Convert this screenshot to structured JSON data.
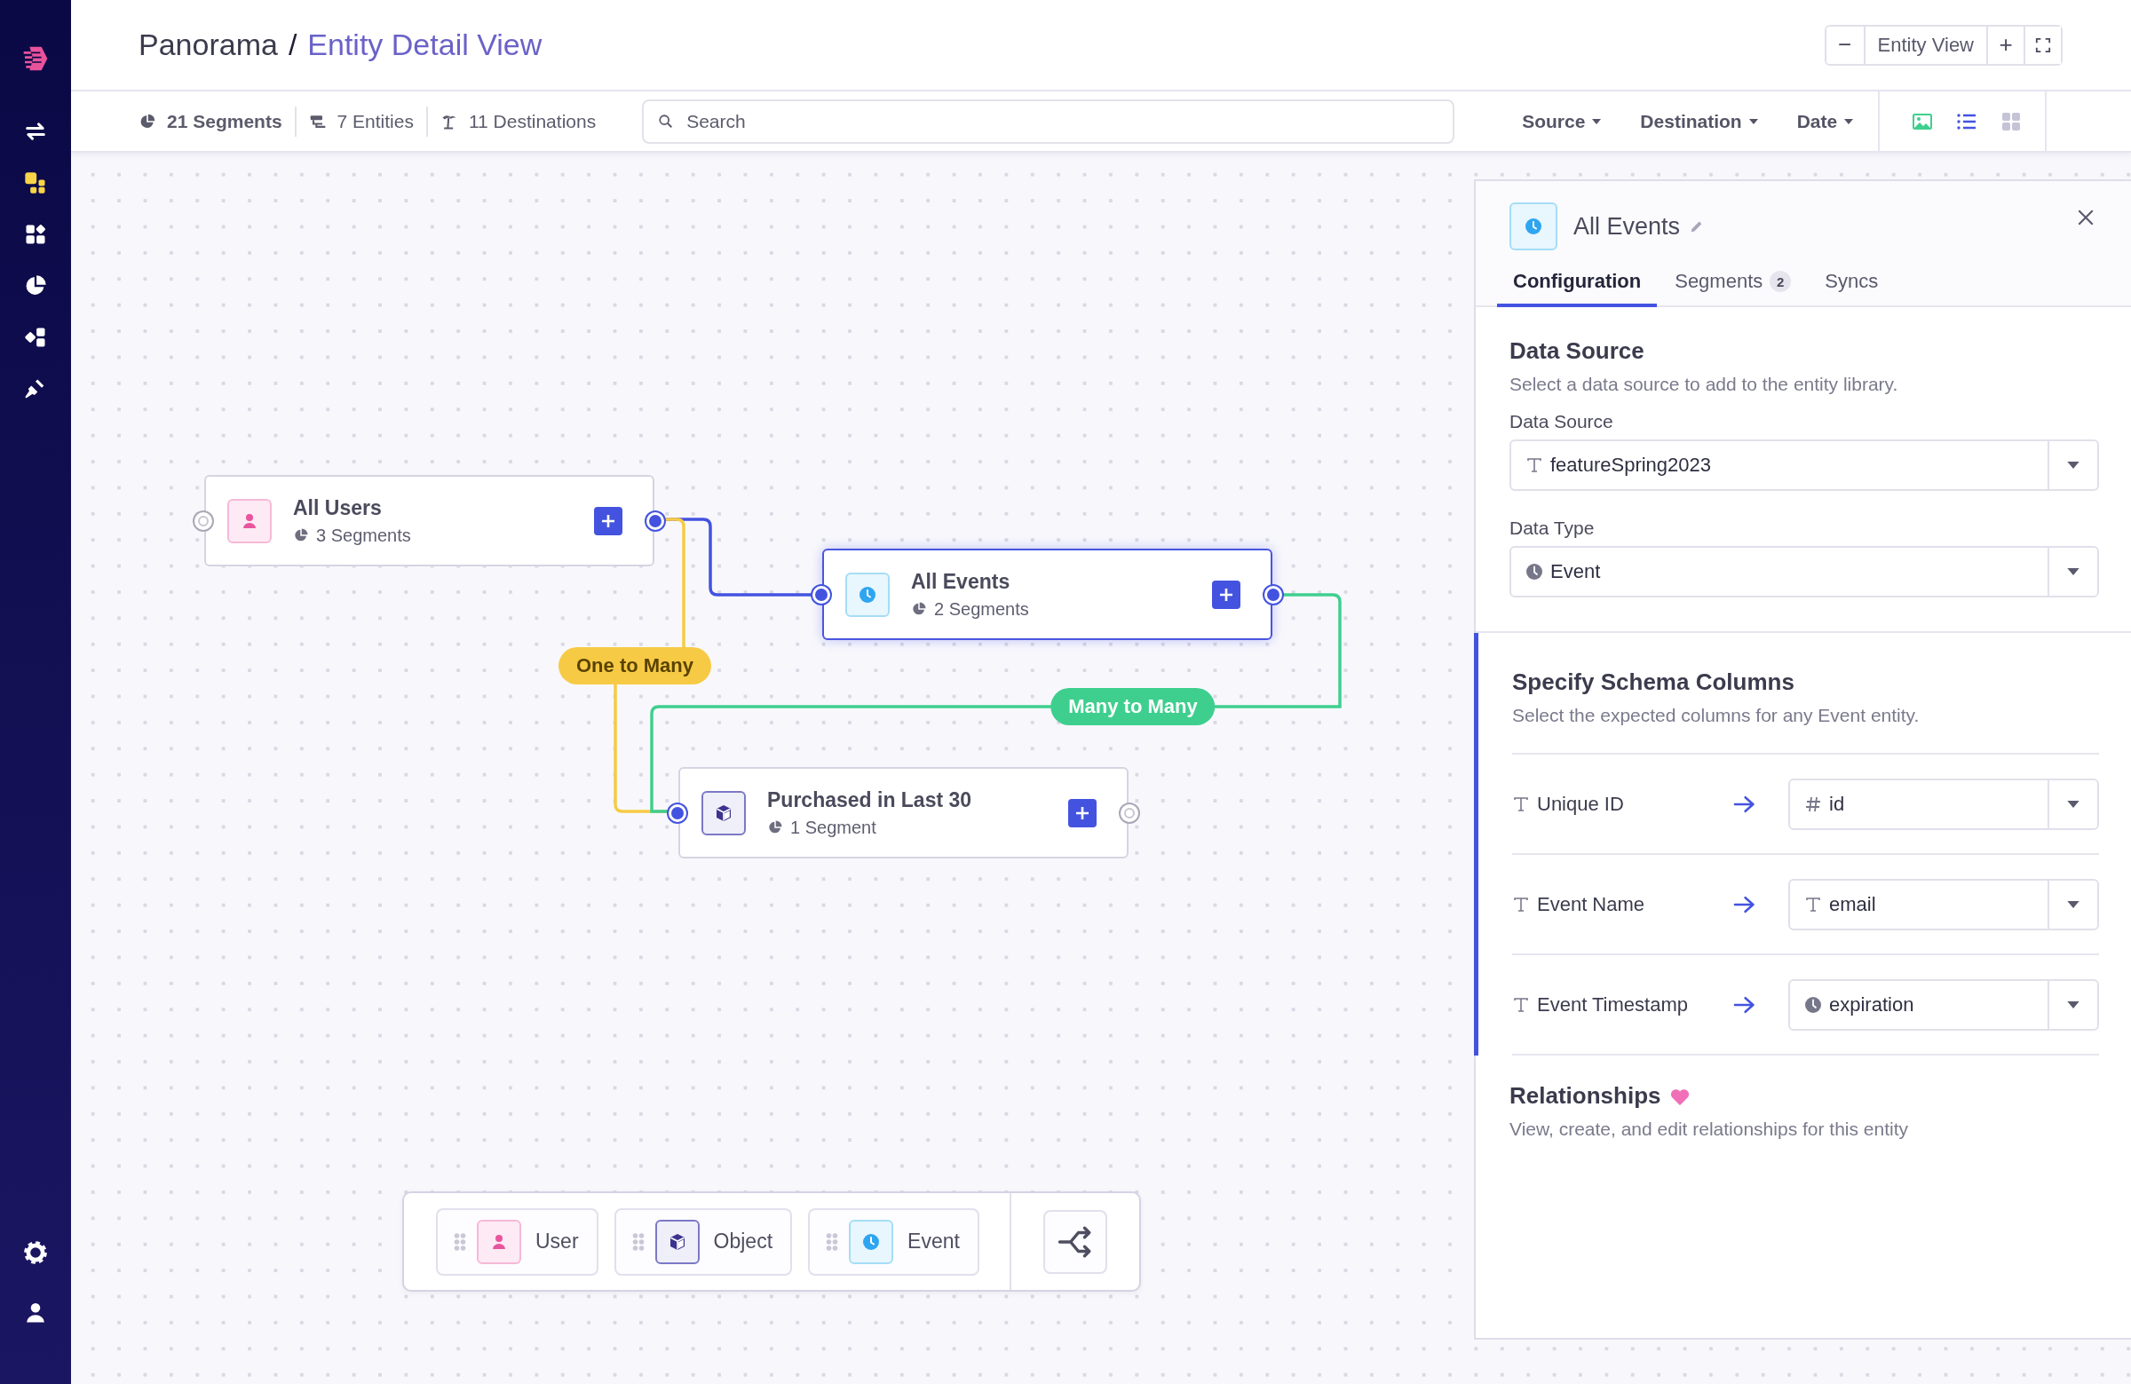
{
  "sidebar": {
    "items": [
      {
        "kind": "swap",
        "selected": false
      },
      {
        "kind": "entities",
        "selected": true
      },
      {
        "kind": "apps",
        "selected": false
      },
      {
        "kind": "segments",
        "selected": false
      },
      {
        "kind": "flows",
        "selected": false
      },
      {
        "kind": "plugins",
        "selected": false
      }
    ],
    "bottom_items": [
      {
        "kind": "settings"
      },
      {
        "kind": "profile"
      }
    ]
  },
  "header": {
    "breadcrumb": {
      "root": "Panorama",
      "separator": "/",
      "current": "Entity Detail View"
    },
    "zoom": {
      "minus": "−",
      "label": "Entity View",
      "plus": "+"
    }
  },
  "toolbar": {
    "stats": [
      {
        "kind": "segments",
        "text": "21 Segments"
      },
      {
        "kind": "entities",
        "text": "7 Entities"
      },
      {
        "kind": "destinations",
        "text": "11 Destinations"
      }
    ],
    "search": {
      "placeholder": "Search"
    },
    "filters": [
      "Source",
      "Destination",
      "Date"
    ],
    "view_modes": [
      {
        "kind": "picture",
        "color": "#3ecf8e"
      },
      {
        "kind": "list",
        "color": "#4353e0"
      },
      {
        "kind": "grid",
        "color": "#c5c3d6"
      }
    ]
  },
  "nodes": [
    {
      "kind": "user",
      "title": "All Users",
      "segments": "3 Segments",
      "selected": false,
      "left_connected": false,
      "right_connected": true
    },
    {
      "kind": "event",
      "title": "All Events",
      "segments": "2 Segments",
      "selected": true,
      "left_connected": true,
      "right_connected": true
    },
    {
      "kind": "object",
      "title": "Purchased in Last 30",
      "segments": "1 Segment",
      "selected": false,
      "left_connected": true,
      "right_connected": false
    }
  ],
  "edges": [
    {
      "color": "#4353e0"
    },
    {
      "label": "One to Many",
      "color": "#f7ca45"
    },
    {
      "label": "Many to Many",
      "color": "#3ecf8e"
    }
  ],
  "palette": [
    {
      "kind": "user",
      "label": "User"
    },
    {
      "kind": "object",
      "label": "Object"
    },
    {
      "kind": "event",
      "label": "Event"
    }
  ],
  "panel": {
    "kind": "event",
    "title": "All Events",
    "tabs": [
      {
        "label": "Configuration",
        "selected": true
      },
      {
        "label": "Segments",
        "count": "2",
        "selected": false
      },
      {
        "label": "Syncs",
        "selected": false
      }
    ],
    "data_source": {
      "heading": "Data Source",
      "description": "Select a data source to add to the entity library.",
      "fields": [
        {
          "label": "Data Source",
          "kind": "text",
          "value": "featureSpring2023"
        },
        {
          "label": "Data Type",
          "kind": "time",
          "value": "Event"
        }
      ]
    },
    "schema": {
      "active": true,
      "heading": "Specify Schema Columns",
      "description": "Select the expected columns for any Event entity.",
      "mappings": [
        {
          "name": "Unique ID",
          "kind": "number",
          "value": "id"
        },
        {
          "name": "Event Name",
          "kind": "text",
          "value": "email"
        },
        {
          "name": "Event Timestamp",
          "kind": "time",
          "value": "expiration"
        }
      ]
    },
    "relationships": {
      "heading": "Relationships",
      "description": "View, create, and edit relationships for this entity"
    }
  }
}
